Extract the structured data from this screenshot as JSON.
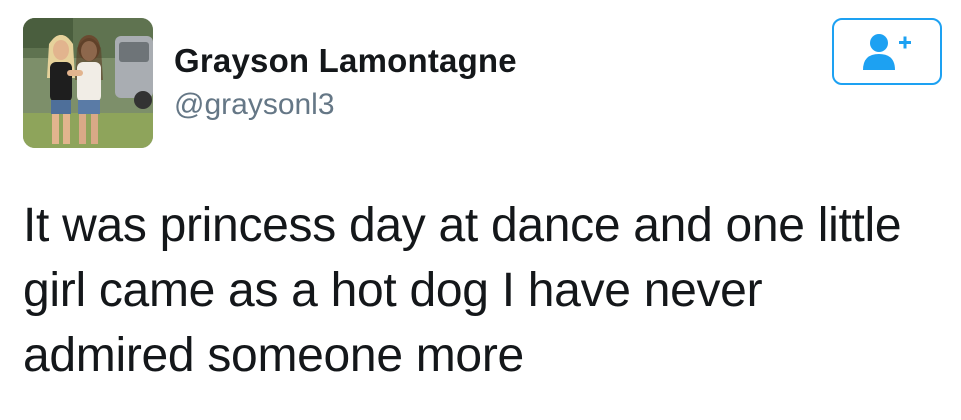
{
  "user": {
    "display_name": "Grayson Lamontagne",
    "handle": "@graysonl3"
  },
  "follow_button": {
    "icon": "add-user-icon",
    "color": "#1da1f2"
  },
  "tweet": {
    "lines": [
      "It was princess day at dance and one little",
      "girl came as a hot dog I have never",
      "admired someone more"
    ]
  }
}
